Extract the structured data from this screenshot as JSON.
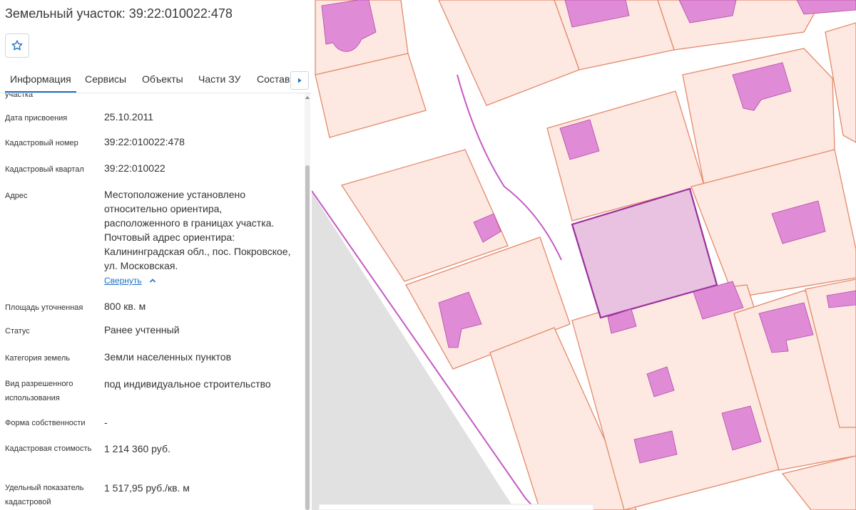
{
  "header": {
    "title": "Земельный участок: 39:22:010022:478"
  },
  "tabs": [
    {
      "label": "Информация",
      "active": true
    },
    {
      "label": "Сервисы"
    },
    {
      "label": "Объекты"
    },
    {
      "label": "Части ЗУ"
    },
    {
      "label": "Состав"
    }
  ],
  "info": {
    "cut_label": "участка",
    "fields": [
      {
        "label": "Дата присвоения",
        "value": "25.10.2011"
      },
      {
        "label": "Кадастровый номер",
        "value": "39:22:010022:478"
      },
      {
        "label": "Кадастровый квартал",
        "value": "39:22:010022"
      },
      {
        "label": "Адрес",
        "value": "Местоположение установлено относительно ориентира, расположенного в границах участка. Почтовый адрес ориентира: Калининградская обл., пос. Покровское, ул. Московская.",
        "link": "Свернуть"
      },
      {
        "label": "Площадь уточненная",
        "value": "800 кв. м"
      },
      {
        "label": "Статус",
        "value": "Ранее учтенный"
      },
      {
        "label": "Категория земель",
        "value": "Земли населенных пунктов"
      },
      {
        "label": "Вид разрешенного использования",
        "value": "под индивидуальное строительство"
      },
      {
        "label": "Форма собственности",
        "value": "-"
      },
      {
        "label": "Кадастровая стоимость",
        "value": "1 214 360 руб."
      },
      {
        "label": "Удельный показатель кадастровой",
        "value": "1 517,95 руб./кв. м"
      }
    ]
  },
  "icons": {
    "favorite": "star-outline-icon",
    "tabs_next": "caret-right-icon",
    "collapse": "chevron-up-icon"
  },
  "colors": {
    "accent": "#1f6fc5",
    "parcel_fill": "#fde9e1",
    "parcel_stroke": "#e3896b",
    "building_fill": "#e08bd6",
    "selected_fill": "#e8c2e0",
    "selected_stroke": "#9b2f9b",
    "road_line": "#c35bc3",
    "grey_zone": "#e0e0e0"
  }
}
